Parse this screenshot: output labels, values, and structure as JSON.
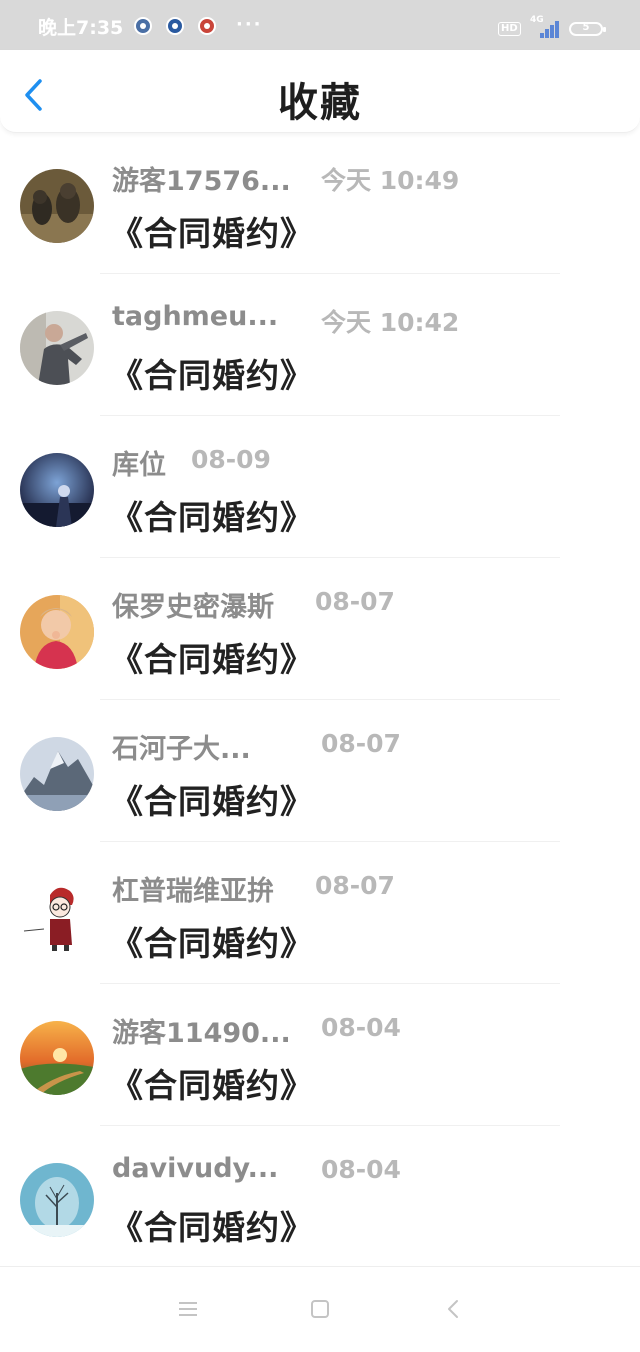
{
  "status_bar": {
    "time": "晚上7:35",
    "more": "···",
    "hd": "HD",
    "network": "4G",
    "battery": "5",
    "icons": [
      "app-notification-icon",
      "app-notification-icon",
      "app-notification-icon"
    ]
  },
  "header": {
    "title": "收藏",
    "back_icon": "chevron-left-icon",
    "accent_color": "#1e8ff0"
  },
  "favorites": [
    {
      "user": "游客17576...",
      "time": "今天 10:49",
      "title": "《合同婚约》",
      "avatar": "cats-photo"
    },
    {
      "user": "taghmeu...",
      "time": "今天 10:42",
      "title": "《合同婚约》",
      "avatar": "person-photo"
    },
    {
      "user": "库位",
      "time": "08-09",
      "title": "《合同婚约》",
      "avatar": "night-scene"
    },
    {
      "user": "保罗史密瀑斯",
      "time": "08-07",
      "title": "《合同婚约》",
      "avatar": "child-photo"
    },
    {
      "user": "石河子大...",
      "time": "08-07",
      "title": "《合同婚约》",
      "avatar": "mountain-photo"
    },
    {
      "user": "杠普瑞维亚拚",
      "time": "08-07",
      "title": "《合同婚约》",
      "avatar": "sketch-character"
    },
    {
      "user": "游客11490...",
      "time": "08-04",
      "title": "《合同婚约》",
      "avatar": "sunset-landscape"
    },
    {
      "user": "davivudy...",
      "time": "08-04",
      "title": "《合同婚约》",
      "avatar": "winter-tree"
    }
  ],
  "nav_bar": {
    "icons": [
      "menu-icon",
      "home-square-icon",
      "back-triangle-icon"
    ]
  }
}
